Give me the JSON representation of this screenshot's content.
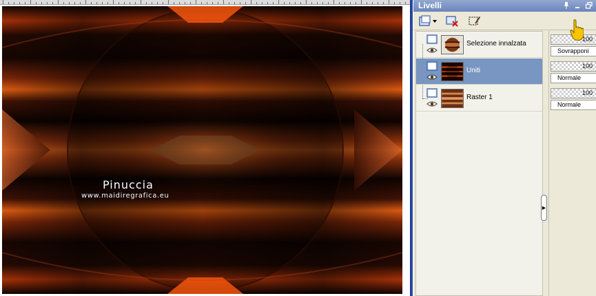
{
  "watermark": {
    "name": "Pinuccia",
    "url": "www.maidiregrafica.eu"
  },
  "palette": {
    "title": "Livelli",
    "titlebar_icons": [
      "pin-icon",
      "minimize-icon",
      "restore-icon"
    ],
    "toolbar_icons": [
      "new-layer-icon",
      "dropdown-arrow-icon",
      "delete-layer-icon",
      "edit-selection-icon"
    ]
  },
  "layers": [
    {
      "name": "Selezione innalzata",
      "opacity": "100",
      "blend": "Sovrapponi",
      "selected": false,
      "icon": "raster-layer-icon",
      "visible": true
    },
    {
      "name": "Uniti",
      "opacity": "100",
      "blend": "Normale",
      "selected": true,
      "icon": "raster-layer-icon",
      "visible": true
    },
    {
      "name": "Raster 1",
      "opacity": "100",
      "blend": "Normale",
      "selected": false,
      "icon": "raster-layer-icon",
      "visible": true
    }
  ],
  "colors": {
    "accent_selected_row": "#7896c1",
    "titlebar": "#7b93c6",
    "image_dark": "#160803",
    "image_orange": "#ff5a0e"
  }
}
